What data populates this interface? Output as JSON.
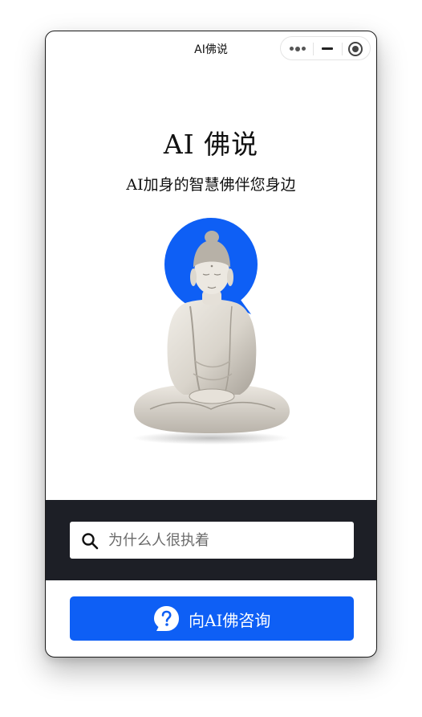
{
  "navbar": {
    "title": "AI佛说",
    "capsule": {
      "more_icon": "more-dots-icon",
      "minimize_icon": "minimize-icon",
      "close_icon": "target-circle-icon"
    }
  },
  "hero": {
    "title": "AI 佛说",
    "subtitle": "AI加身的智慧佛伴您身边",
    "image": "meditating-buddha-statue",
    "accent_color": "#0e5ff5"
  },
  "search": {
    "placeholder": "为什么人很执着",
    "icon": "search-icon",
    "band_color": "#1d1f26"
  },
  "ask_button": {
    "label": "向AI佛咨询",
    "icon": "question-bubble-icon",
    "color": "#0e5ff5"
  }
}
